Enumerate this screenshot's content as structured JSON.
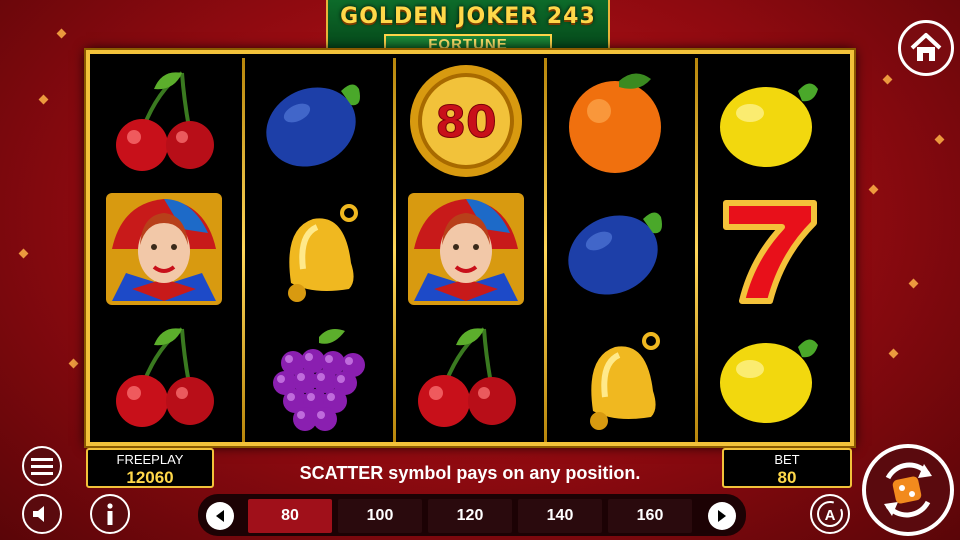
{
  "header": {
    "title": "GOLDEN JOKER 243",
    "subtitle": "FORTUNE"
  },
  "reels": [
    [
      "cherry",
      "joker",
      "cherry"
    ],
    [
      "plum",
      "bell",
      "grapes"
    ],
    [
      "coin-80",
      "joker",
      "cherry"
    ],
    [
      "orange",
      "plum",
      "bell"
    ],
    [
      "lemon",
      "seven",
      "lemon"
    ]
  ],
  "coin_value": "80",
  "freeplay": {
    "label": "FREEPLAY",
    "value": "12060"
  },
  "bet": {
    "label": "BET",
    "value": "80"
  },
  "message": "SCATTER symbol pays on any position.",
  "bet_options": [
    "80",
    "100",
    "120",
    "140",
    "160"
  ],
  "selected_bet_index": 0,
  "autoplay_letter": "A",
  "colors": {
    "frame": "#f2c23a",
    "background": "#b0111a",
    "accent": "#ffd84a",
    "selected": "#a0101a"
  }
}
